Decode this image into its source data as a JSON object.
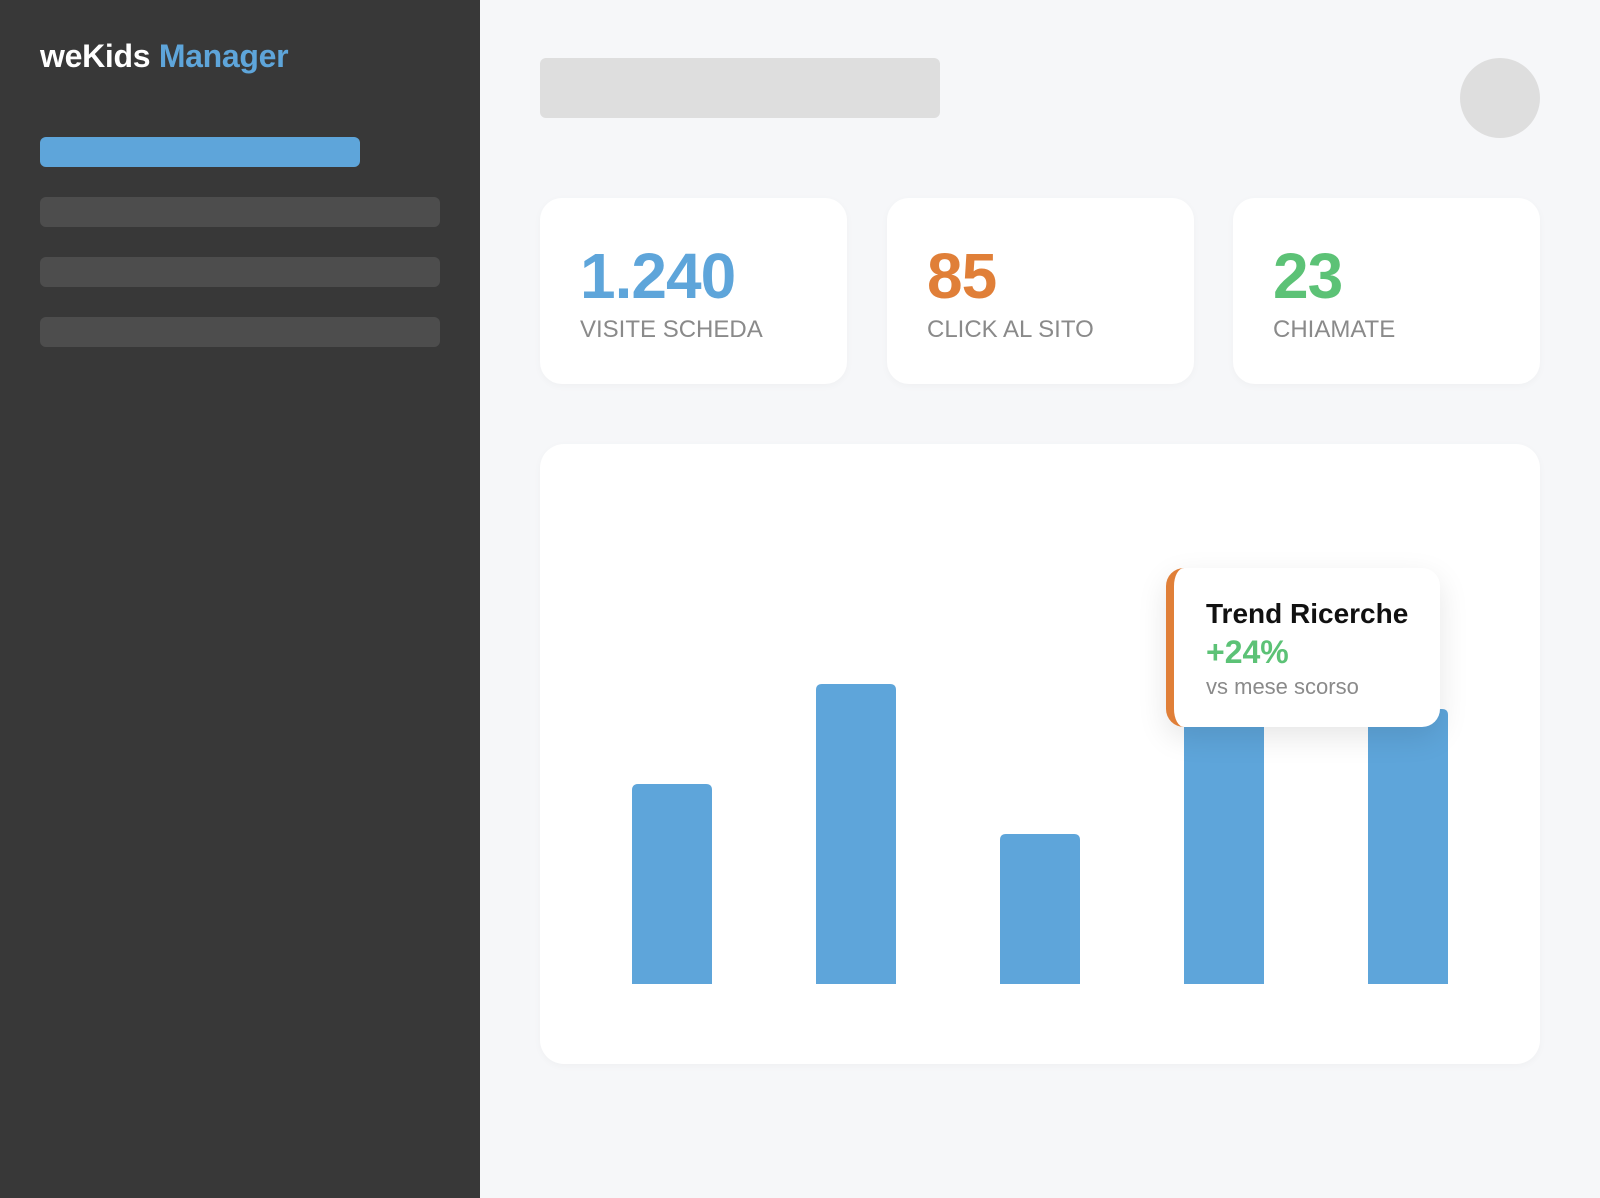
{
  "brand": {
    "name_part1": "weKids",
    "name_part2": "Manager"
  },
  "stats": [
    {
      "value": "1.240",
      "label": "VISITE SCHEDA",
      "color": "#5ea5da"
    },
    {
      "value": "85",
      "label": "CLICK AL SITO",
      "color": "#e07f38"
    },
    {
      "value": "23",
      "label": "CHIAMATE",
      "color": "#5cc276"
    }
  ],
  "tooltip": {
    "title": "Trend Ricerche",
    "change": "+24%",
    "subtitle": "vs mese scorso",
    "accent_color": "#e07f38",
    "change_color": "#5cc276"
  },
  "chart_data": {
    "type": "bar",
    "categories": [
      "",
      "",
      "",
      "",
      ""
    ],
    "values": [
      40,
      60,
      30,
      60,
      55
    ],
    "ylim": [
      0,
      100
    ],
    "grid": false,
    "bar_color": "#5ea5da"
  },
  "colors": {
    "sidebar_bg": "#383838",
    "accent_blue": "#5ea5da",
    "accent_orange": "#e07f38",
    "accent_green": "#5cc276",
    "page_bg": "#f6f7f9"
  }
}
